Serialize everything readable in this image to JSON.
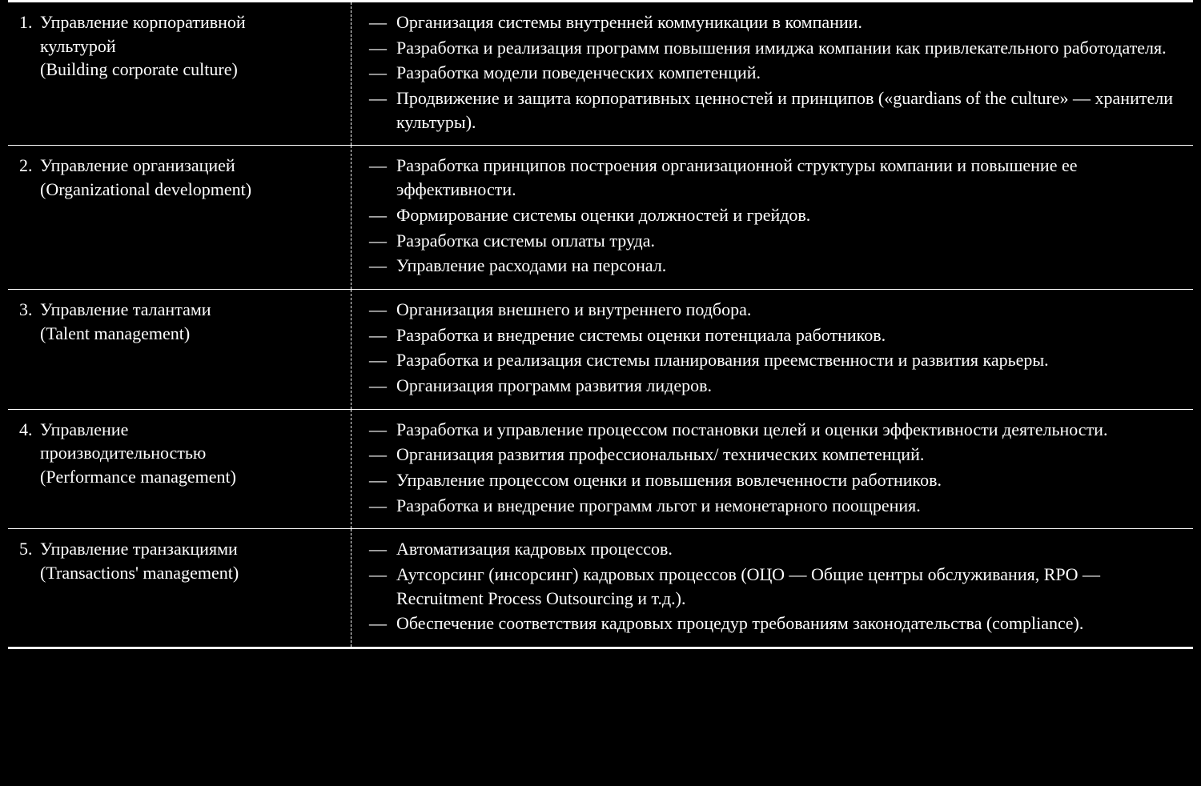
{
  "rows": [
    {
      "num": "1.",
      "title_lines": [
        "Управление корпоративной",
        "культурой",
        "(Building corporate culture)"
      ],
      "items": [
        "Организация системы внутренней коммуникации в компании.",
        "Разработка и реализация программ повышения имиджа компании как привлекательного работодателя.",
        "Разработка модели поведенческих компетенций.",
        "Продвижение и защита корпоративных ценностей и принципов («guardians of the culture» — хранители культуры)."
      ]
    },
    {
      "num": "2.",
      "title_lines": [
        "Управление организацией",
        "(Organizational development)"
      ],
      "items": [
        "Разработка принципов построения организационной структуры компании и повышение ее эффективности.",
        "Формирование системы оценки должностей и грейдов.",
        "Разработка системы оплаты труда.",
        "Управление расходами на персонал."
      ]
    },
    {
      "num": "3.",
      "title_lines": [
        "Управление талантами",
        "(Talent management)"
      ],
      "items": [
        "Организация внешнего и внутреннего подбора.",
        "Разработка и внедрение системы оценки потенциала работников.",
        "Разработка и реализация системы планирования преемственности и развития карьеры.",
        "Организация программ развития лидеров."
      ]
    },
    {
      "num": "4.",
      "title_lines": [
        "Управление",
        "производительностью",
        "(Performance management)"
      ],
      "items": [
        "Разработка и управление процессом постановки целей и оценки эффективности деятельности.",
        "Организация развития профессиональных/ технических компетенций.",
        "Управление процессом оценки и повышения вовлеченности работников.",
        "Разработка и внедрение программ льгот и немонетарного поощрения."
      ]
    },
    {
      "num": "5.",
      "title_lines": [
        "Управление транзакциями",
        "(Transactions' management)"
      ],
      "items": [
        "Автоматизация кадровых процессов.",
        "Аутсорсинг (инсорсинг) кадровых процессов (ОЦО — Общие центры обслуживания, RPO — Recruitment Process Outsourcing и т.д.).",
        "Обеспечение соответствия кадровых процедур требованиям законодательства (compliance)."
      ]
    }
  ]
}
